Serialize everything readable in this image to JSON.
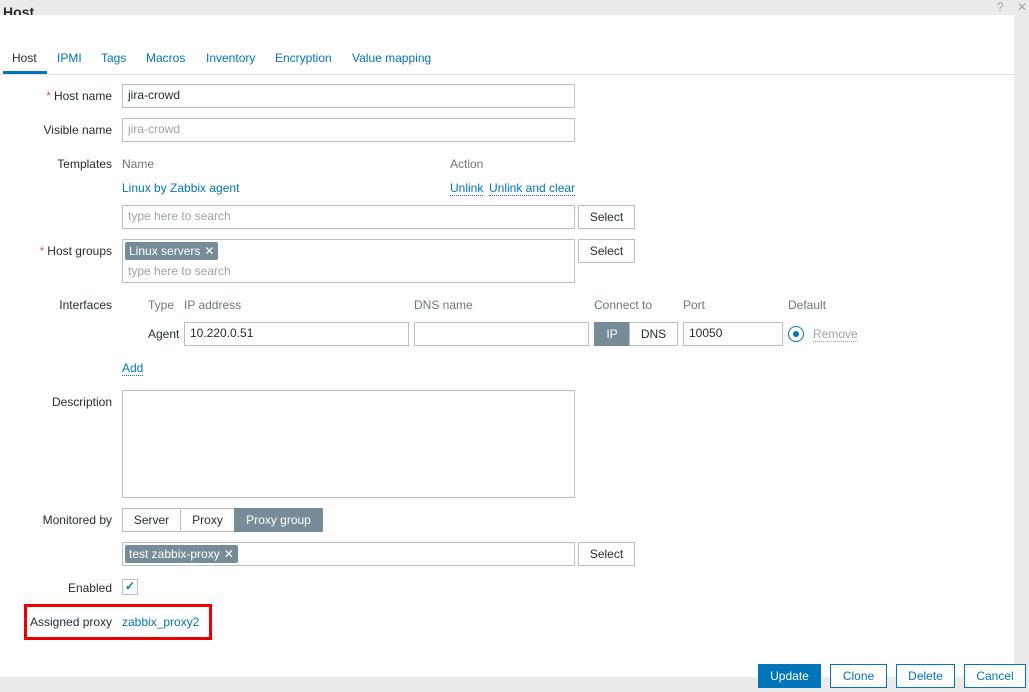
{
  "window": {
    "title": "Host",
    "help_glyph": "?",
    "close_glyph": "✕"
  },
  "tabs": [
    {
      "label": "Host"
    },
    {
      "label": "IPMI"
    },
    {
      "label": "Tags"
    },
    {
      "label": "Macros"
    },
    {
      "label": "Inventory"
    },
    {
      "label": "Encryption"
    },
    {
      "label": "Value mapping"
    }
  ],
  "form": {
    "host_name": {
      "label": "Host name",
      "required_mark": "*",
      "value": "jira-crowd"
    },
    "visible_name": {
      "label": "Visible name",
      "placeholder": "jira-crowd"
    },
    "templates": {
      "label": "Templates",
      "col_name": "Name",
      "col_action": "Action",
      "item": "Linux by Zabbix agent",
      "unlink": "Unlink",
      "unlink_clear": "Unlink and clear",
      "search_placeholder": "type here to search",
      "select_label": "Select"
    },
    "host_groups": {
      "label": "Host groups",
      "required_mark": "*",
      "chip": "Linux servers",
      "search_placeholder": "type here to search",
      "select_label": "Select"
    },
    "interfaces": {
      "label": "Interfaces",
      "col_type": "Type",
      "col_ip": "IP address",
      "col_dns": "DNS name",
      "col_connect": "Connect to",
      "col_port": "Port",
      "col_default": "Default",
      "type": "Agent",
      "ip": "10.220.0.51",
      "dns": "",
      "connect_ip": "IP",
      "connect_dns": "DNS",
      "port": "10050",
      "remove": "Remove",
      "add": "Add"
    },
    "description": {
      "label": "Description",
      "value": ""
    },
    "monitored_by": {
      "label": "Monitored by",
      "options": [
        "Server",
        "Proxy",
        "Proxy group"
      ],
      "selected": "Proxy group",
      "chip": "test zabbix-proxy",
      "select_label": "Select"
    },
    "enabled": {
      "label": "Enabled",
      "checked": true,
      "check_glyph": "✓"
    },
    "assigned_proxy": {
      "label": "Assigned proxy",
      "value": "zabbix_proxy2"
    }
  },
  "chip_remove_glyph": "✕",
  "footer": {
    "update": "Update",
    "clone": "Clone",
    "delete": "Delete",
    "cancel": "Cancel"
  },
  "colors": {
    "accent": "#0275b8",
    "chip": "#768d99",
    "required": "#e45959",
    "highlight": "#ee0000"
  }
}
